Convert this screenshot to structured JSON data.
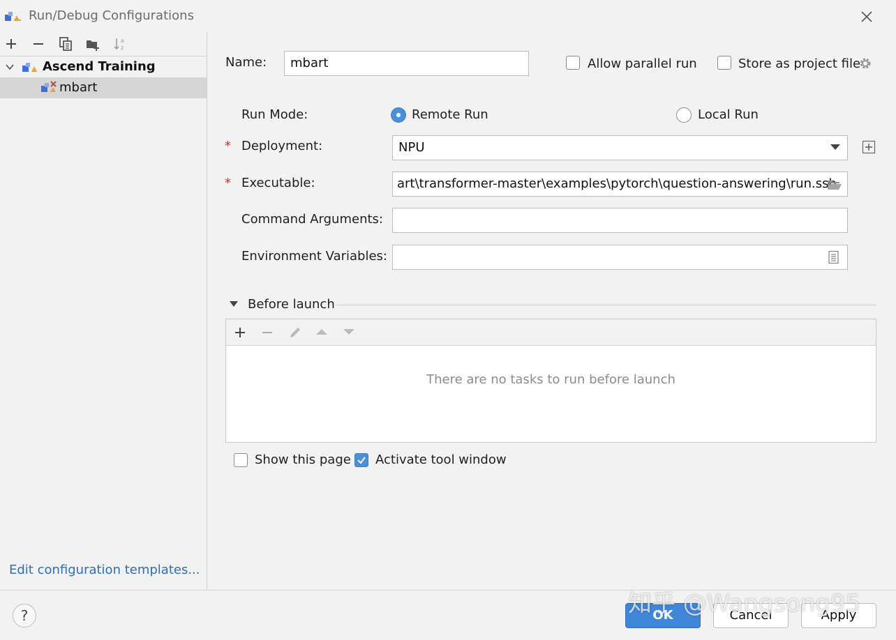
{
  "window": {
    "title": "Run/Debug Configurations"
  },
  "toolbar": {
    "add_icon": "plus-icon",
    "remove_icon": "minus-icon",
    "copy_icon": "copy-icon",
    "folder_icon": "new-folder-icon",
    "sort_icon": "sort-alpha-icon"
  },
  "tree": {
    "group_label": "Ascend Training",
    "item_label": "mbart"
  },
  "left_footer": {
    "templates_link": "Edit configuration templates..."
  },
  "form": {
    "name_label": "Name:",
    "name_value": "mbart",
    "allow_parallel_label": "Allow parallel run",
    "allow_parallel_checked": false,
    "store_project_label": "Store as project file",
    "store_project_checked": false,
    "run_mode_label": "Run Mode:",
    "remote_run_label": "Remote Run",
    "local_run_label": "Local Run",
    "run_mode_selected": "Remote Run",
    "required_marker": "*",
    "deployment_label": "Deployment:",
    "deployment_value": "NPU",
    "executable_label": "Executable:",
    "executable_value": "art\\transformer-master\\examples\\pytorch\\question-answering\\run.ssh",
    "command_args_label": "Command Arguments:",
    "command_args_value": "",
    "env_vars_label": "Environment Variables:",
    "env_vars_value": ""
  },
  "before_launch": {
    "title": "Before launch",
    "empty_text": "There are no tasks to run before launch",
    "show_page_label": "Show this page",
    "show_page_checked": false,
    "activate_tool_label": "Activate tool window",
    "activate_tool_checked": true
  },
  "buttons": {
    "help": "?",
    "ok": "OK",
    "cancel": "Cancel",
    "apply": "Apply"
  },
  "watermark": "知乎 @Wangsong95",
  "colors": {
    "accent": "#4a90d9",
    "link": "#2f6db5",
    "selection": "#d5d5d5",
    "required": "#c0392b"
  }
}
